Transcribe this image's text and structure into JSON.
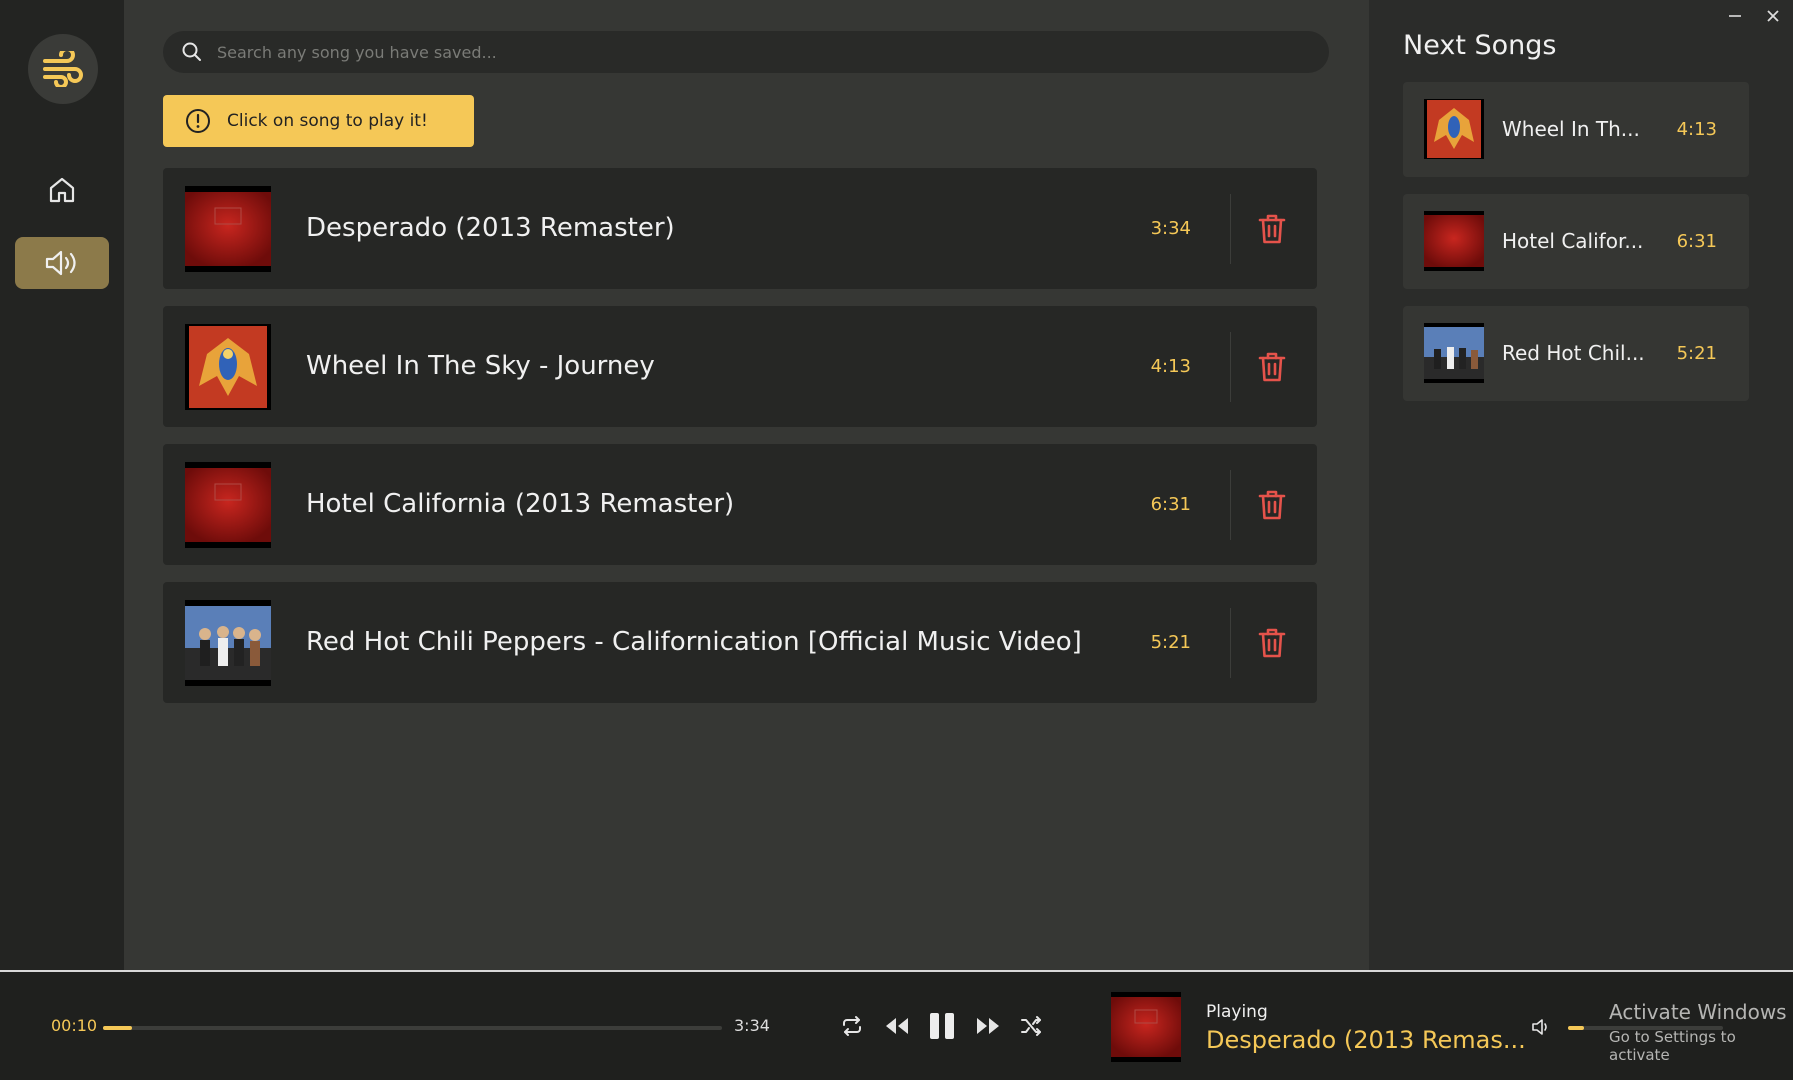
{
  "sidebar": {
    "logo_icon": "wind-icon",
    "items": [
      {
        "name": "home",
        "icon": "home-icon",
        "active": false
      },
      {
        "name": "now-playing",
        "icon": "speaker-icon",
        "active": true
      }
    ]
  },
  "search": {
    "placeholder": "Search any song you have saved..."
  },
  "hint": {
    "text": "Click on song to play it!",
    "icon": "info-icon"
  },
  "songs": [
    {
      "title": "Desperado (2013 Remaster)",
      "duration": "3:34",
      "art": "red"
    },
    {
      "title": "Wheel In The Sky - Journey",
      "duration": "4:13",
      "art": "journey"
    },
    {
      "title": "Hotel California (2013 Remaster)",
      "duration": "6:31",
      "art": "red"
    },
    {
      "title": "Red Hot Chili Peppers - Californication [Official Music Video]",
      "duration": "5:21",
      "art": "band"
    }
  ],
  "next": {
    "title": "Next Songs",
    "items": [
      {
        "name": "Wheel In Th...",
        "duration": "4:13",
        "art": "journey"
      },
      {
        "name": "Hotel Califor...",
        "duration": "6:31",
        "art": "red"
      },
      {
        "name": "Red Hot Chil...",
        "duration": "5:21",
        "art": "band"
      }
    ]
  },
  "player": {
    "current_time": "00:10",
    "total_time": "3:34",
    "progress_fraction": 0.047,
    "playing_label": "Playing",
    "now_playing_title": "Desperado (2013 Remas...",
    "volume_fraction": 0.1
  },
  "watermark": {
    "line1": "Activate Windows",
    "line2": "Go to Settings to activate"
  },
  "colors": {
    "accent": "#f5c857",
    "danger": "#e5534b",
    "sidebar_active": "#8c7a4a"
  }
}
